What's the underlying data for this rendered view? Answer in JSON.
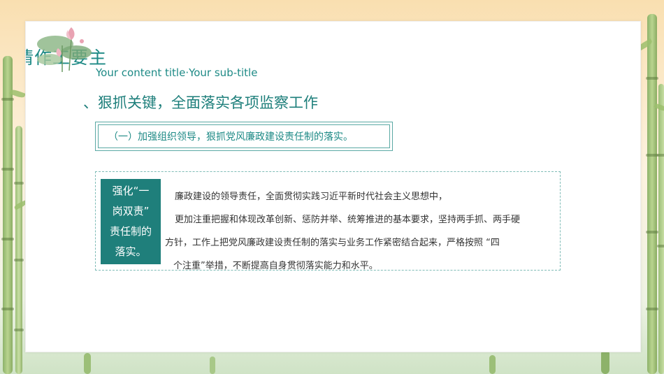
{
  "header": {
    "title": "况情作工要主",
    "subtitle": "Your content title·Your sub-title"
  },
  "section": {
    "heading": "、狠抓关键，全面落实各项监察工作"
  },
  "point_box": {
    "text": "（一）加强组织领导，狠抓党风廉政建设责任制的落实。"
  },
  "detail": {
    "label_lines": [
      "强化“一",
      "岗双责”",
      "责任制的",
      "落实。"
    ],
    "body_lines": [
      "廉政建设的领导责任，全面贯彻实践习近平新时代社会主义思想中，",
      "更加注重把握和体现改革创新、惩防并举、统筹推进的基本要求，坚持两手抓、两手硬",
      "方针，工作上把党风廉政建设责任制的落实与业务工作紧密结合起来，严格按照 “四",
      "个注重”举措，不断提高自身贯彻落实能力和水平。"
    ]
  },
  "colors": {
    "accent": "#1e8a86",
    "label_bg": "#1f7f7b"
  },
  "icons": [
    "lotus-illustration",
    "bamboo-decoration"
  ]
}
